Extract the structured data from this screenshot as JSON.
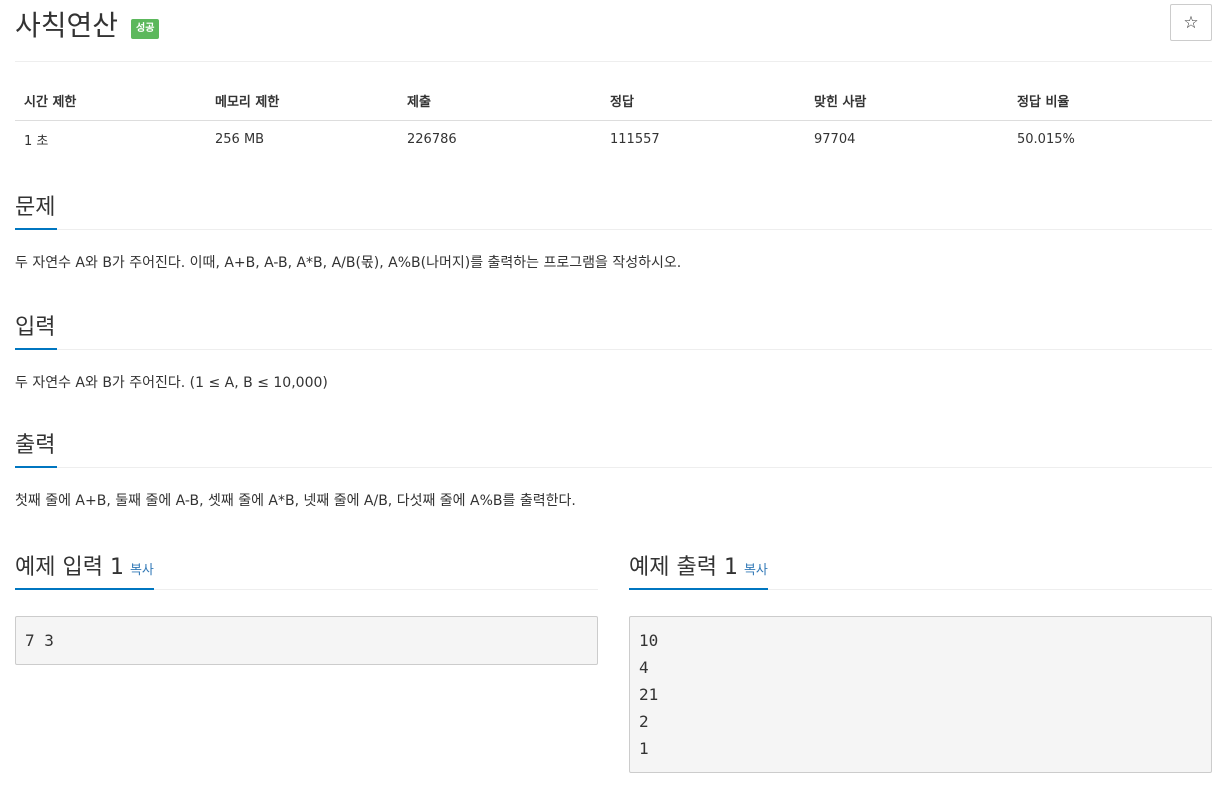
{
  "problem": {
    "title": "사칙연산",
    "status": "성공",
    "star_icon": "☆"
  },
  "info_table": {
    "headers": [
      "시간 제한",
      "메모리 제한",
      "제출",
      "정답",
      "맞힌 사람",
      "정답 비율"
    ],
    "values": [
      "1 초",
      "256 MB",
      "226786",
      "111557",
      "97704",
      "50.015%"
    ]
  },
  "sections": {
    "description": {
      "title": "문제",
      "text": "두 자연수 A와 B가 주어진다. 이때, A+B, A-B, A*B, A/B(몫), A%B(나머지)를 출력하는 프로그램을 작성하시오."
    },
    "input": {
      "title": "입력",
      "text": "두 자연수 A와 B가 주어진다. (1 ≤ A, B ≤ 10,000)"
    },
    "output": {
      "title": "출력",
      "text": "첫째 줄에 A+B, 둘째 줄에 A-B, 셋째 줄에 A*B, 넷째 줄에 A/B, 다섯째 줄에 A%B를 출력한다."
    }
  },
  "samples": {
    "input": {
      "title": "예제 입력 1",
      "copy_label": "복사",
      "lines": [
        "7 3"
      ]
    },
    "output": {
      "title": "예제 출력 1",
      "copy_label": "복사",
      "lines": [
        "10",
        "4",
        "21",
        "2",
        "1"
      ]
    }
  },
  "colors": {
    "accent": "#0076c0",
    "success_badge": "#5cb85c",
    "link": "#337ab7"
  }
}
